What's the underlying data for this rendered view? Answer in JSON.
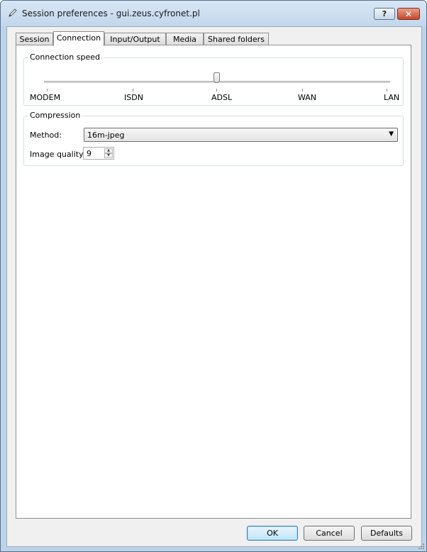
{
  "window": {
    "title": "Session preferences - gui.zeus.cyfronet.pl",
    "help_label": "?",
    "close_label": "✕"
  },
  "tabs": [
    {
      "label": "Session"
    },
    {
      "label": "Connection",
      "active": true
    },
    {
      "label": "Input/Output"
    },
    {
      "label": "Media"
    },
    {
      "label": "Shared folders"
    }
  ],
  "connection_speed": {
    "group_label": "Connection speed",
    "levels": [
      "MODEM",
      "ISDN",
      "ADSL",
      "WAN",
      "LAN"
    ],
    "selected": "ADSL",
    "selected_index": 2
  },
  "compression": {
    "group_label": "Compression",
    "method_label": "Method:",
    "method_value": "16m-jpeg",
    "quality_label": "Image quality:",
    "quality_value": "9"
  },
  "buttons": {
    "ok": "OK",
    "cancel": "Cancel",
    "defaults": "Defaults"
  },
  "colors": {
    "title_bar": "#c2d7ec",
    "close_button": "#c6472c",
    "default_button": "#bee6fd"
  }
}
